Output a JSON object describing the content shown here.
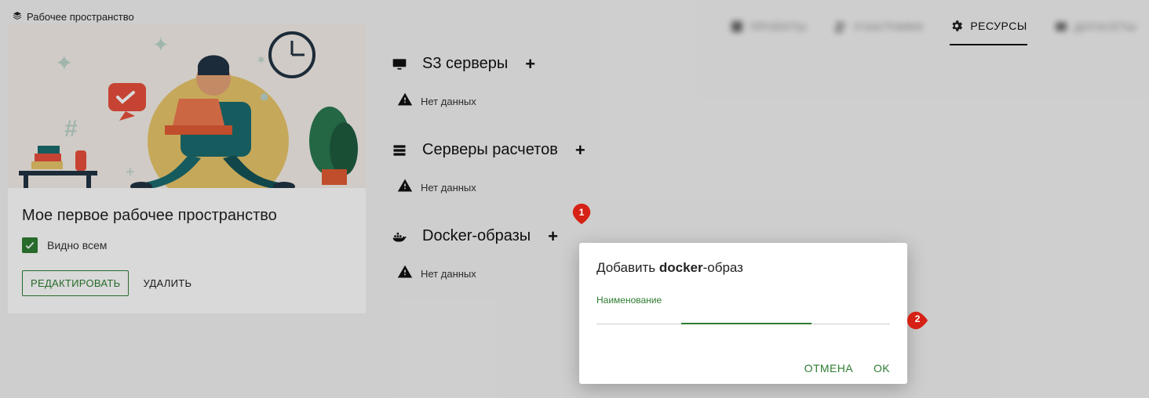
{
  "breadcrumb": {
    "label": "Рабочее пространство"
  },
  "tabs": {
    "blurred": [
      "ПРОЕКТЫ",
      "УЧАСТНИКИ"
    ],
    "active": "РЕСУРСЫ",
    "blurred_after": [
      "ДАТАСЕТЫ"
    ]
  },
  "card": {
    "title": "Мое первое рабочее пространство",
    "visibility_label": "Видно всем",
    "edit_label": "РЕДАКТИРОВАТЬ",
    "delete_label": "УДАЛИТЬ"
  },
  "sections": {
    "s3": {
      "title": "S3 серверы",
      "empty": "Нет данных"
    },
    "compute": {
      "title": "Серверы расчетов",
      "empty": "Нет данных"
    },
    "docker": {
      "title": "Docker-образы",
      "empty": "Нет данных"
    }
  },
  "dialog": {
    "title_prefix": "Добавить ",
    "title_bold": "docker",
    "title_suffix": "-образ",
    "field_label": "Наименование",
    "field_value": "",
    "cancel": "ОТМЕНА",
    "ok": "OK"
  },
  "annotations": {
    "pin1": "1",
    "pin2": "2"
  }
}
